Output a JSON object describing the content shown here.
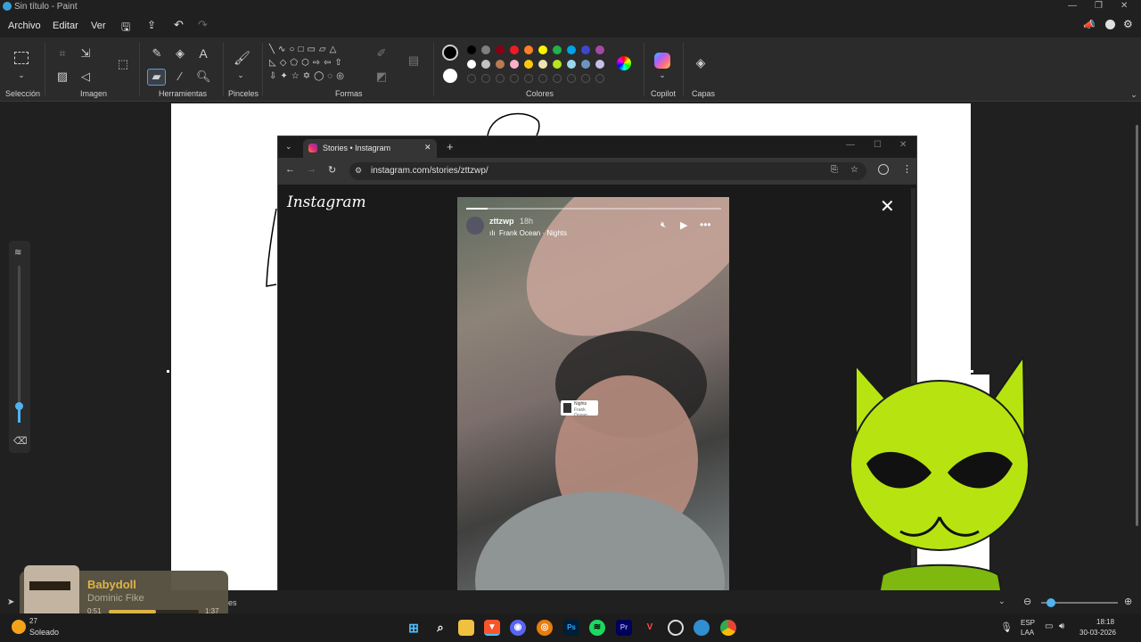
{
  "window": {
    "title": "Sin título - Paint"
  },
  "menu": {
    "items": [
      "Archivo",
      "Editar",
      "Ver"
    ]
  },
  "ribbon": {
    "groups": [
      "Selección",
      "Imagen",
      "Herramientas",
      "Pinceles",
      "Formas",
      "Colores",
      "Copilot",
      "Capas"
    ]
  },
  "colors": {
    "row1": [
      "#000000",
      "#7f7f7f",
      "#880015",
      "#ed1c24",
      "#ff7f27",
      "#fff200",
      "#22b14c",
      "#00a2e8",
      "#3f48cc",
      "#a349a4"
    ],
    "row2": [
      "#ffffff",
      "#c3c3c3",
      "#b97a57",
      "#ffaec9",
      "#ffc90e",
      "#efe4b0",
      "#b5e61d",
      "#99d9ea",
      "#7092be",
      "#c8bfe7"
    ],
    "primary": "#000000",
    "secondary": "#ffffff"
  },
  "browser": {
    "tab_title": "Stories • Instagram",
    "url": "instagram.com/stories/zttzwp/",
    "logo": "Instagram",
    "story": {
      "username": "zttzwp",
      "time": "18h",
      "music": "Frank Ocean · Nights",
      "sticker_title": "Nights",
      "sticker_artist": "Frank Ocean"
    }
  },
  "media_player": {
    "song": "Babydoll",
    "artist": "Dominic Fike",
    "elapsed": "0:51",
    "duration": "1:37",
    "progress": 0.52
  },
  "weather": {
    "label": "Soleado",
    "temp": "27"
  },
  "status_text": "es",
  "taskbar": {
    "lang": "ESP",
    "layout": "LAA",
    "time": "18:18",
    "date": "30-03-2026"
  }
}
